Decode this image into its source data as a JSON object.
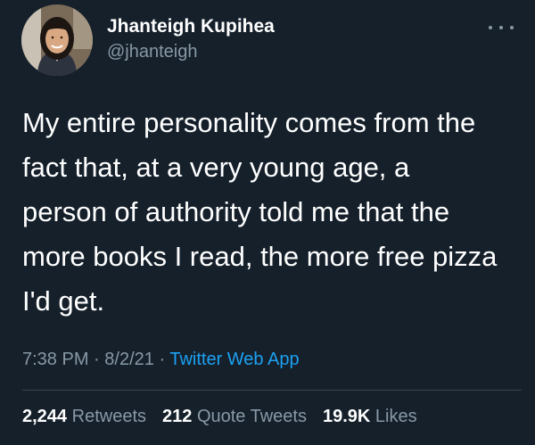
{
  "user": {
    "display_name": "Jhanteigh Kupihea",
    "handle": "@jhanteigh"
  },
  "tweet": {
    "lines": [
      "My entire personality comes from the",
      "fact that, at a very young age, a",
      "person of authority told me that the",
      "more books I read, the more free pizza",
      "I'd get."
    ],
    "time": "7:38 PM",
    "date": "8/2/21",
    "separator": "·",
    "source": "Twitter Web App"
  },
  "stats": {
    "retweets": {
      "count": "2,244",
      "label": "Retweets"
    },
    "quote_tweets": {
      "count": "212",
      "label": "Quote Tweets"
    },
    "likes": {
      "count": "19.9K",
      "label": "Likes"
    }
  },
  "icons": {
    "more": "more-horizontal-icon"
  },
  "colors": {
    "background": "#15202b",
    "text": "#ffffff",
    "secondary": "#8899a6",
    "link": "#1da1f2",
    "divider": "#38444d"
  }
}
